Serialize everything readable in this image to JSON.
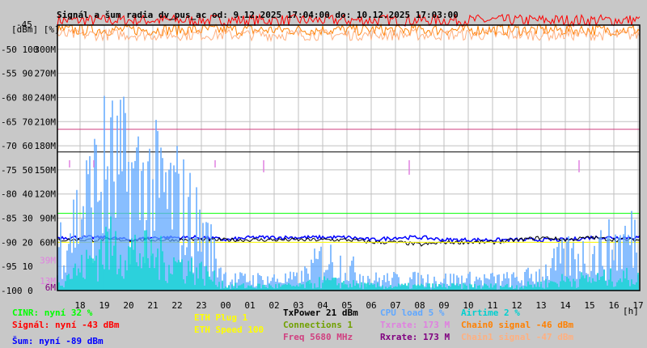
{
  "chart_data": {
    "type": "line",
    "title": "Signál a šum radia dv_pus_ac od: 9.12.2025 17:04:00 do: 10.12.2025 17:03:00",
    "ylabel_left": "[dBm] [%]",
    "xlabel": "[h]",
    "ylim": [
      -100,
      -45
    ],
    "y_ticks_dbm": [
      -45,
      -50,
      -55,
      -60,
      -65,
      -70,
      -75,
      -80,
      -85,
      -90,
      -95,
      -100
    ],
    "y_ticks_pct": [
      "",
      "100",
      "90",
      "80",
      "70",
      "60",
      "50",
      "40",
      "30",
      "20",
      "10",
      "0"
    ],
    "y_ticks_rate": [
      "",
      "300M",
      "270M",
      "240M",
      "210M",
      "180M",
      "150M",
      "120M",
      "90M",
      "60M",
      "",
      ""
    ],
    "rate_markers": [
      {
        "label": "39M",
        "color": "#e080e0",
        "dbm": -93.7
      },
      {
        "label": "13M",
        "color": "#e080e0",
        "dbm": -98
      },
      {
        "label": "6M",
        "color": "#800080",
        "dbm": -99.3
      }
    ],
    "x_ticks": [
      "18",
      "19",
      "20",
      "21",
      "22",
      "23",
      "00",
      "01",
      "02",
      "03",
      "04",
      "05",
      "06",
      "07",
      "08",
      "09",
      "10",
      "11",
      "12",
      "13",
      "14",
      "15",
      "16",
      "17"
    ],
    "x_range_hours": [
      0,
      24
    ],
    "grid": true,
    "series": [
      {
        "name": "Signál",
        "color": "#ff0000",
        "unit": "dBm",
        "values": [
          -44,
          -44,
          -44,
          -44,
          -44,
          -44,
          -44,
          -44,
          -44,
          -44,
          -44,
          -44,
          -44,
          -44,
          -44,
          -44,
          -44,
          -44,
          -44,
          -44,
          -44,
          -44,
          -44,
          -44,
          -44
        ]
      },
      {
        "name": "Chain0 signal",
        "color": "#ff8000",
        "unit": "dBm",
        "values": [
          -46,
          -46,
          -46,
          -46,
          -46,
          -46,
          -46,
          -46,
          -46,
          -46,
          -46,
          -46,
          -46,
          -46,
          -46,
          -46,
          -46,
          -46,
          -46,
          -46,
          -46,
          -46,
          -46,
          -46,
          -46
        ]
      },
      {
        "name": "Chain1 signal",
        "color": "#ffb080",
        "unit": "dBm",
        "values": [
          -47,
          -47,
          -47,
          -47,
          -47,
          -47,
          -47,
          -47,
          -47,
          -47,
          -47,
          -47,
          -47,
          -47,
          -47,
          -47,
          -47,
          -47,
          -47,
          -47,
          -47,
          -47,
          -47,
          -47,
          -47
        ]
      },
      {
        "name": "Freq",
        "color": "#d04080",
        "unit": "dBm-scale",
        "values": [
          -66.6,
          -66.6,
          -66.6,
          -66.6,
          -66.6,
          -66.6,
          -66.6,
          -66.6,
          -66.6,
          -66.6,
          -66.6,
          -66.6,
          -66.6,
          -66.6,
          -66.6,
          -66.6,
          -66.6,
          -66.6,
          -66.6,
          -66.6,
          -66.6,
          -66.6,
          -66.6,
          -66.6,
          -66.6
        ]
      },
      {
        "name": "TxPower",
        "color": "#000000",
        "unit": "dBm-scale",
        "values": [
          -71.3,
          -71.3,
          -71.3,
          -71.3,
          -71.3,
          -71.3,
          -71.3,
          -71.3,
          -71.3,
          -71.3,
          -71.3,
          -71.3,
          -71.3,
          -71.3,
          -71.3,
          -71.3,
          -71.3,
          -71.3,
          -71.3,
          -71.3,
          -71.3,
          -71.3,
          -71.3,
          -71.3,
          -71.3
        ]
      },
      {
        "name": "CINR",
        "color": "#00ff00",
        "unit": "%",
        "values": [
          32,
          32,
          32,
          32,
          32,
          32,
          32,
          32,
          32,
          32,
          32,
          32,
          32,
          32,
          32,
          32,
          32,
          32,
          32,
          32,
          32,
          32,
          32,
          32,
          32
        ]
      },
      {
        "name": "Šum",
        "color": "#0000ff",
        "unit": "dBm",
        "values": [
          -89,
          -89,
          -89,
          -89.5,
          -89,
          -89,
          -89,
          -89.5,
          -89,
          -89,
          -89,
          -89,
          -89,
          -89.5,
          -89,
          -89,
          -89.5,
          -89.5,
          -89.5,
          -89.5,
          -89.5,
          -89.5,
          -89,
          -89,
          -89
        ]
      },
      {
        "name": "Rxrate",
        "color": "#000000",
        "unit": "dBm-scale",
        "values": [
          -89.5,
          -89.5,
          -89.5,
          -89.5,
          -89.5,
          -89.5,
          -89.5,
          -89.5,
          -89.5,
          -89.5,
          -89.5,
          -89.5,
          -89.5,
          -90,
          -90,
          -90.5,
          -90,
          -90,
          -90,
          -89.5,
          -89,
          -89.5,
          -89,
          -89.5,
          -89.5
        ]
      },
      {
        "name": "ETH Speed",
        "color": "#ffff00",
        "unit": "dBm-scale",
        "values": [
          -90,
          -90,
          -90,
          -90,
          -90,
          -90,
          -90,
          -90,
          -90,
          -90,
          -90,
          -90,
          -90,
          -90,
          -90,
          -90,
          -90,
          -90,
          -90,
          -90,
          -90,
          -90,
          -90,
          -90,
          -90
        ]
      },
      {
        "name": "CPU load",
        "color": "#60a8ff",
        "unit": "%",
        "values": [
          20,
          35,
          55,
          50,
          45,
          40,
          25,
          5,
          5,
          5,
          5,
          15,
          10,
          5,
          5,
          5,
          5,
          5,
          5,
          5,
          8,
          15,
          15,
          20,
          25
        ]
      },
      {
        "name": "Airtime",
        "color": "#00d0d0",
        "unit": "%",
        "values": [
          5,
          10,
          20,
          18,
          15,
          12,
          8,
          2,
          2,
          2,
          2,
          4,
          3,
          2,
          2,
          2,
          2,
          2,
          2,
          2,
          3,
          5,
          5,
          6,
          6
        ]
      },
      {
        "name": "Txrate",
        "color": "#e080e0",
        "unit": "spikes-dBm",
        "values": [
          -74.5,
          -74.5,
          null,
          null,
          null,
          null,
          -74.5,
          null,
          -75.5,
          null,
          null,
          null,
          null,
          null,
          -76,
          null,
          null,
          null,
          null,
          null,
          null,
          -75.5,
          null,
          null,
          -75.5
        ]
      }
    ]
  },
  "legend": {
    "cinr": "CINR: nyní 32 %",
    "signal": "Signál: nyní -43 dBm",
    "noise": "Šum: nyní -89 dBm",
    "eth_plug": "ETH Plug 1",
    "eth_speed": "ETH Speed 100",
    "txpower": "TxPower 21 dBm",
    "connections": "Connections 1",
    "freq": "Freq 5680 MHz",
    "cpu": "CPU load 5 %",
    "txrate": "Txrate: 173 M",
    "rxrate": "Rxrate: 173 M",
    "airtime": "Airtime 2 %",
    "chain0": "Chain0 signal -46 dBm",
    "chain1": "Chain1 signal -47 dBm"
  },
  "colors": {
    "cinr": "#00ff00",
    "signal": "#ff0000",
    "noise": "#0000ff",
    "eth": "#ffff00",
    "txpower": "#000000",
    "connections": "#70a000",
    "freq": "#d04080",
    "cpu": "#60a8ff",
    "txrate": "#e080e0",
    "rxrate": "#800080",
    "airtime": "#00d0d0",
    "chain0": "#ff8000",
    "chain1": "#ffb080"
  }
}
